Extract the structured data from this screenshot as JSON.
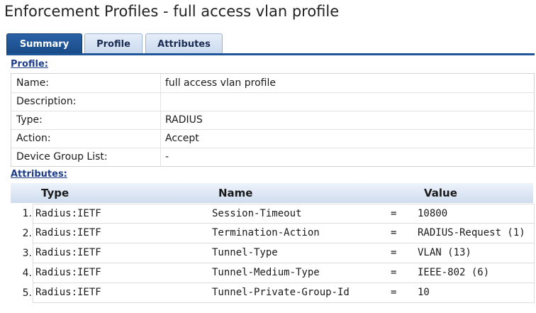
{
  "page": {
    "title": "Enforcement Profiles - full access vlan profile"
  },
  "tabs": [
    {
      "label": "Summary",
      "active": true
    },
    {
      "label": "Profile",
      "active": false
    },
    {
      "label": "Attributes",
      "active": false
    }
  ],
  "profile": {
    "heading": "Profile:",
    "rows": [
      {
        "label": "Name:",
        "value": "full access vlan profile"
      },
      {
        "label": "Description:",
        "value": ""
      },
      {
        "label": "Type:",
        "value": "RADIUS"
      },
      {
        "label": "Action:",
        "value": "Accept"
      },
      {
        "label": "Device Group List:",
        "value": "-"
      }
    ]
  },
  "attributes": {
    "heading": "Attributes:",
    "columns": {
      "type": "Type",
      "name": "Name",
      "value": "Value"
    },
    "rows": [
      {
        "num": "1.",
        "type": "Radius:IETF",
        "name": "Session-Timeout",
        "op": "=",
        "value": "10800"
      },
      {
        "num": "2.",
        "type": "Radius:IETF",
        "name": "Termination-Action",
        "op": "=",
        "value": "RADIUS-Request (1)"
      },
      {
        "num": "3.",
        "type": "Radius:IETF",
        "name": "Tunnel-Type",
        "op": "=",
        "value": "VLAN (13)"
      },
      {
        "num": "4.",
        "type": "Radius:IETF",
        "name": "Tunnel-Medium-Type",
        "op": "=",
        "value": "IEEE-802 (6)"
      },
      {
        "num": "5.",
        "type": "Radius:IETF",
        "name": "Tunnel-Private-Group-Id",
        "op": "=",
        "value": "10"
      }
    ]
  },
  "colors": {
    "tab_active": "#1f5599",
    "tab_inactive": "#d6e2f3",
    "link": "#1f3e8a"
  }
}
